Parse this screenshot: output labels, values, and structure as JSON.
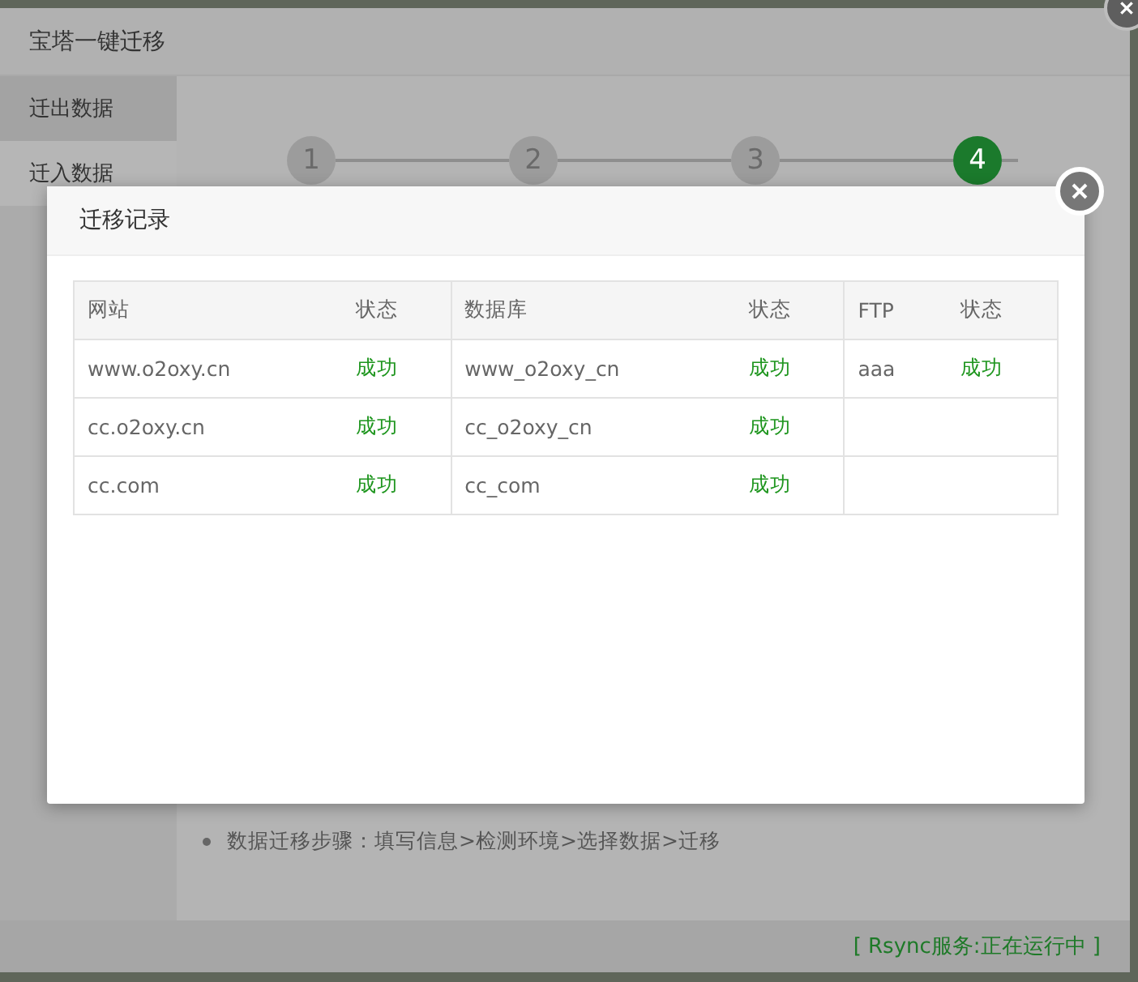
{
  "window": {
    "title": "宝塔一键迁移"
  },
  "sidebar": {
    "items": [
      {
        "label": "迁出数据",
        "selected": true
      },
      {
        "label": "迁入数据",
        "selected": false
      }
    ]
  },
  "steps": [
    {
      "label": "1",
      "selected": false
    },
    {
      "label": "2",
      "selected": false
    },
    {
      "label": "3",
      "selected": false
    },
    {
      "label": "4",
      "selected": true
    }
  ],
  "note": "数据迁移步骤：填写信息>检测环境>选择数据>迁移",
  "status_bar": "[ Rsync服务:正在运行中 ]",
  "dialog": {
    "title": "迁移记录",
    "columns": [
      "网站",
      "状态",
      "数据库",
      "状态",
      "FTP",
      "状态"
    ],
    "rows": [
      {
        "cells": [
          "www.o2oxy.cn",
          "成功",
          "www_o2oxy_cn",
          "成功",
          "aaa",
          "成功"
        ]
      },
      {
        "cells": [
          "cc.o2oxy.cn",
          "成功",
          "cc_o2oxy_cn",
          "成功"
        ]
      },
      {
        "cells": [
          "cc.com",
          "成功",
          "cc_com",
          "成功"
        ]
      }
    ]
  }
}
